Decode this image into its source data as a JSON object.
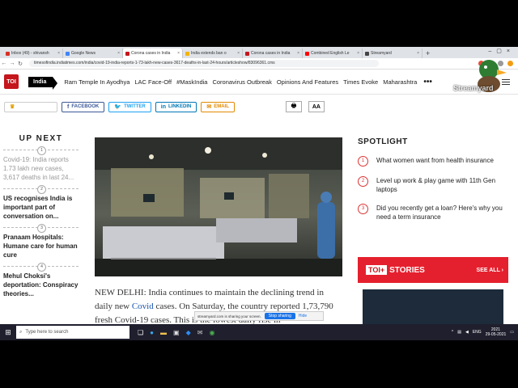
{
  "browser": {
    "tabs": [
      {
        "label": "Inbox (49) - shivansh",
        "color": "#d93025",
        "active": false
      },
      {
        "label": "Google News",
        "color": "#4285f4",
        "active": false
      },
      {
        "label": "Corona cases in India",
        "color": "#c4161c",
        "active": true
      },
      {
        "label": "India extends ban o",
        "color": "#f4b400",
        "active": false
      },
      {
        "label": "Corona cases in India",
        "color": "#c4161c",
        "active": false
      },
      {
        "label": "Combined English Le",
        "color": "#ff0000",
        "active": false
      },
      {
        "label": "Streamyard",
        "color": "#444444",
        "active": false
      }
    ],
    "new_tab": "+",
    "url": "timesofindia.indiatimes.com/india/covid-19-india-reports-1-73-lakh-new-cases-3617-deaths-in-last-24-hours/articleshow/83096361.cms"
  },
  "site": {
    "logo": "TOI",
    "edition": "India",
    "nav": [
      "Ram Temple In Ayodhya",
      "LAC Face-Off",
      "#MaskIndia",
      "Coronavirus Outbreak",
      "Opinions And Features",
      "Times Evoke",
      "Maharashtra"
    ],
    "more": "•••"
  },
  "share": {
    "facebook": "FACEBOOK",
    "twitter": "TWITTER",
    "linkedin": "LINKEDIN",
    "email": "EMAIL",
    "font_tool": "AA"
  },
  "up_next": {
    "title": "UP NEXT",
    "items": [
      {
        "num": "1",
        "text": "Covid-19: India reports 1.73 lakh new cases, 3,617 deaths in last 24...",
        "faded": true
      },
      {
        "num": "2",
        "text": "US recognises India is important part of conversation on...",
        "faded": false
      },
      {
        "num": "3",
        "text": "Pranaam Hospitals: Humane care for human cure",
        "faded": false
      },
      {
        "num": "4",
        "text": "Mehul Choksi's deportation: Conspiracy theories...",
        "faded": false
      }
    ]
  },
  "article": {
    "lead": "NEW DELHI: India continues to maintain the declining trend in daily new ",
    "link": "Covid",
    "rest": " cases. On Saturday, the country reported 1,73,790 fresh Covid-19 cases. This is the lowest daily rise in"
  },
  "spotlight": {
    "title": "SPOTLIGHT",
    "items": [
      {
        "num": "1",
        "text": "What women want from health insurance"
      },
      {
        "num": "2",
        "text": "Level up work & play game with 11th Gen laptops"
      },
      {
        "num": "3",
        "text": "Did you recently get a loan? Here's why you need a term insurance"
      }
    ]
  },
  "stories": {
    "logo": "TOI+",
    "label": "STORIES",
    "see_all": "SEE ALL ›"
  },
  "overlay": {
    "watermark": "Streamyard",
    "sharing_text": "streamyard.com is sharing your screen.",
    "stop": "Stop sharing",
    "hide": "Hide"
  },
  "taskbar": {
    "search_placeholder": "Type here to search",
    "lang": "ENG",
    "time": "2021",
    "date": "29-05-2021"
  }
}
